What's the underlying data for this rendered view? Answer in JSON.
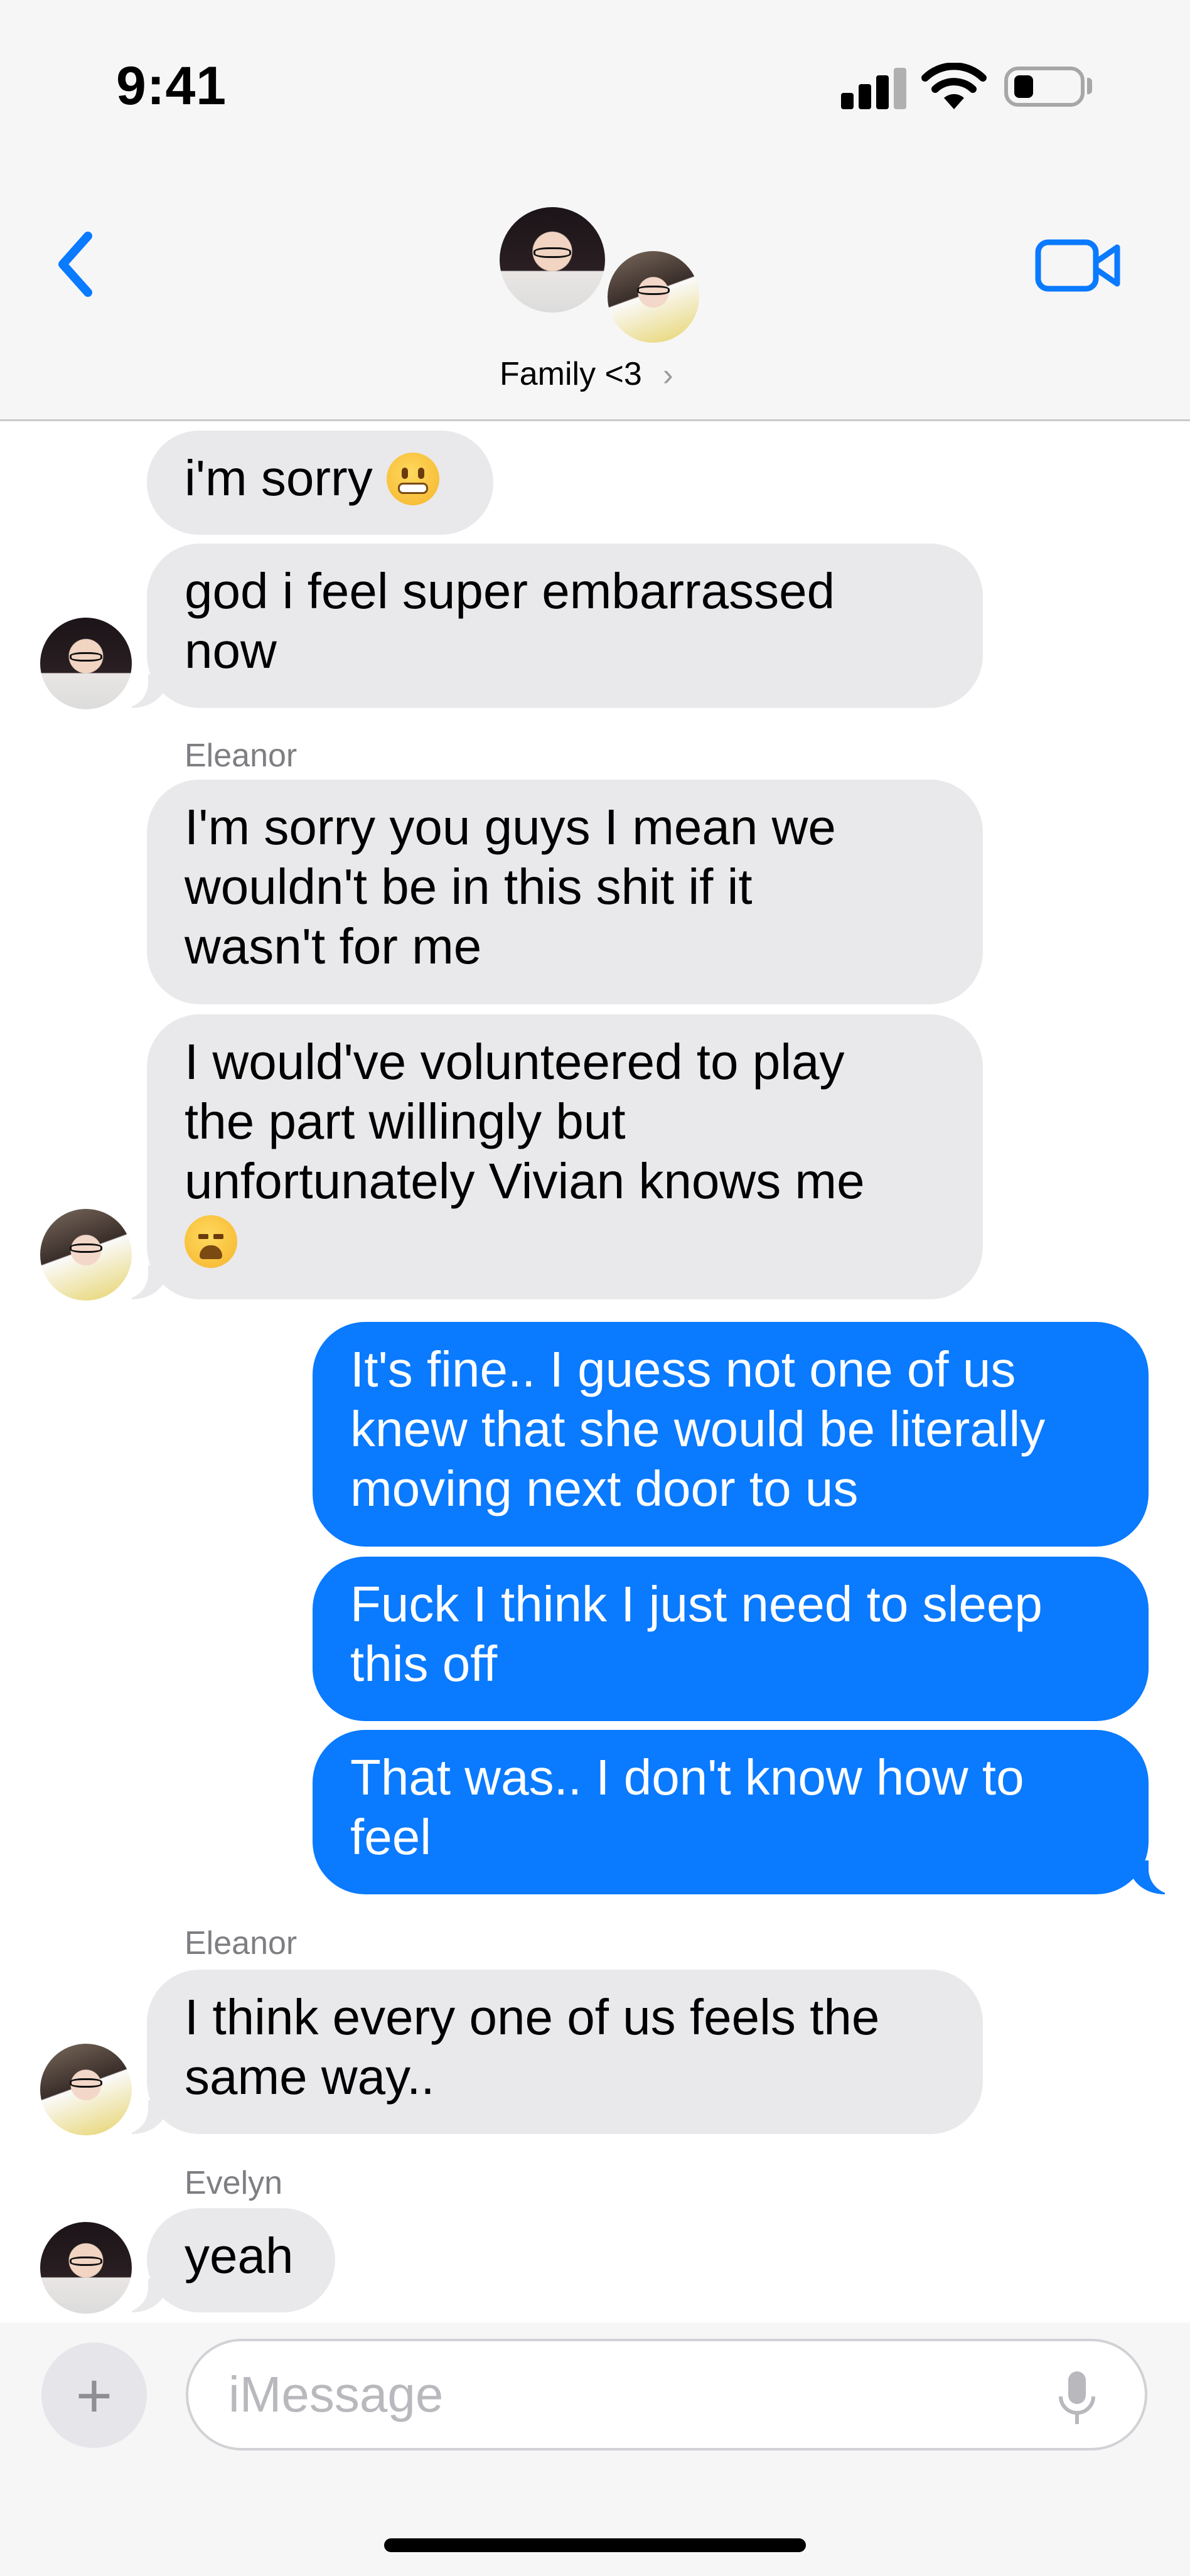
{
  "status_bar": {
    "time": "9:41"
  },
  "header": {
    "group_name": "Family <3",
    "chevron": "›",
    "back_icon": "chevron-left-icon",
    "video_icon": "video-camera-icon",
    "accent_color": "#0a7aff"
  },
  "messages": [
    {
      "side": "in",
      "lines": [
        "i'm sorry"
      ],
      "emoji": "grimacing-face"
    },
    {
      "side": "in",
      "lines": [
        "god i feel super embarrassed",
        "now"
      ]
    },
    {
      "side": "in",
      "sender": "Eleanor",
      "lines": [
        "I'm sorry you guys I mean we",
        "wouldn't be in this shit if it",
        "wasn't for me"
      ]
    },
    {
      "side": "in",
      "lines": [
        "I would've volunteered to play",
        "the part willingly but",
        "unfortunately Vivian knows me"
      ],
      "emoji": "weary-face"
    },
    {
      "side": "out",
      "lines": [
        "It's fine.. I guess not one of us",
        "knew that she would be literally",
        "moving next door to us"
      ]
    },
    {
      "side": "out",
      "lines": [
        "Fuck I think I just need to sleep",
        "this off"
      ]
    },
    {
      "side": "out",
      "lines": [
        "That was.. I don't know how to",
        "feel"
      ]
    },
    {
      "side": "in",
      "sender": "Eleanor",
      "lines": [
        "I think every one of us feels the",
        "same way.."
      ]
    },
    {
      "side": "in",
      "sender": "Evelyn",
      "lines": [
        "yeah"
      ]
    }
  ],
  "composer": {
    "placeholder": "iMessage",
    "plus_label": "+",
    "mic_icon": "microphone-icon"
  },
  "colors": {
    "incoming_bubble": "#e9e9eb",
    "outgoing_bubble": "#0a7aff",
    "sender_label": "#7e7e83"
  }
}
